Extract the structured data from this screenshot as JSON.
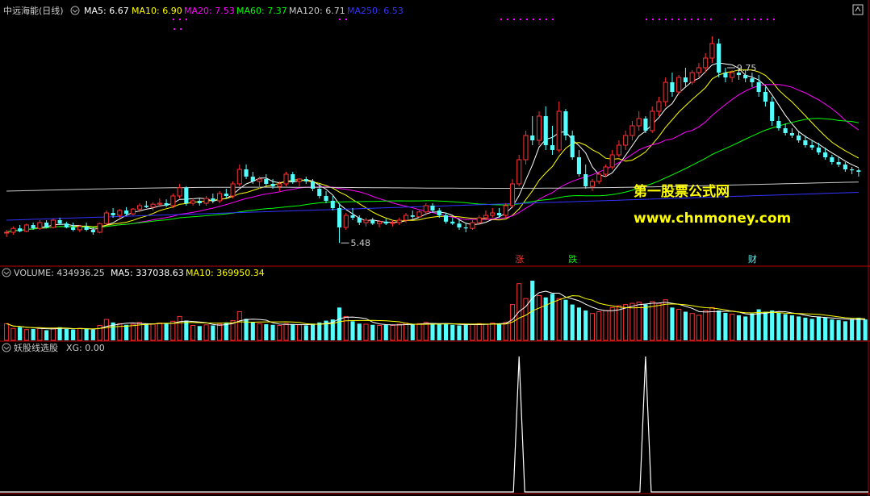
{
  "header": {
    "stock_title": "中远海能(日线)",
    "ma5": "MA5: 6.67",
    "ma10": "MA10: 6.90",
    "ma20": "MA20: 7.53",
    "ma60": "MA60: 7.37",
    "ma120": "MA120: 6.71",
    "ma250": "MA250: 6.53"
  },
  "volume_header": {
    "title": "VOLUME: 434936.25",
    "ma5": "MA5: 337038.63",
    "ma10": "MA10: 369950.34"
  },
  "indicator_header": {
    "title": "妖股线选股",
    "xg": "XG: 0.00"
  },
  "annotations": {
    "high": "9.75",
    "low": "5.48",
    "tag_zhang": "涨",
    "tag_die": "跌",
    "tag_cai": "财"
  },
  "watermark": {
    "line1": "第一股票公式网",
    "line2": "www.chnmoney.com"
  },
  "colors": {
    "up": "#ff3232",
    "down": "#54ffff",
    "ma5": "#ffffff",
    "ma10": "#ffff00",
    "ma20": "#ff00ff",
    "ma60": "#00ff00",
    "ma120": "#cccccc",
    "ma250": "#3333ff",
    "frame": "#b40000",
    "watermark": "#ffff00"
  },
  "chart_data": {
    "type": "candlestick",
    "price_range": [
      5.2,
      10.0
    ],
    "candles": [
      [
        5.7,
        5.75,
        5.6,
        5.7
      ],
      [
        5.7,
        5.82,
        5.65,
        5.78
      ],
      [
        5.78,
        5.85,
        5.7,
        5.72
      ],
      [
        5.72,
        5.88,
        5.7,
        5.85
      ],
      [
        5.85,
        5.9,
        5.75,
        5.78
      ],
      [
        5.78,
        5.95,
        5.75,
        5.9
      ],
      [
        5.9,
        5.95,
        5.78,
        5.8
      ],
      [
        5.8,
        5.98,
        5.78,
        5.95
      ],
      [
        5.95,
        6.0,
        5.85,
        5.88
      ],
      [
        5.88,
        5.92,
        5.78,
        5.8
      ],
      [
        5.8,
        5.9,
        5.72,
        5.75
      ],
      [
        5.75,
        5.85,
        5.7,
        5.82
      ],
      [
        5.82,
        5.9,
        5.72,
        5.75
      ],
      [
        5.75,
        5.82,
        5.65,
        5.7
      ],
      [
        5.7,
        5.9,
        5.68,
        5.88
      ],
      [
        5.88,
        6.15,
        5.85,
        6.1
      ],
      [
        6.1,
        6.2,
        6.0,
        6.05
      ],
      [
        6.05,
        6.18,
        6.0,
        6.15
      ],
      [
        6.15,
        6.22,
        6.05,
        6.08
      ],
      [
        6.08,
        6.2,
        6.05,
        6.18
      ],
      [
        6.18,
        6.3,
        6.12,
        6.25
      ],
      [
        6.25,
        6.35,
        6.2,
        6.22
      ],
      [
        6.22,
        6.32,
        6.15,
        6.28
      ],
      [
        6.28,
        6.4,
        6.22,
        6.3
      ],
      [
        6.3,
        6.38,
        6.22,
        6.25
      ],
      [
        6.25,
        6.5,
        6.2,
        6.45
      ],
      [
        6.45,
        6.7,
        6.4,
        6.62
      ],
      [
        6.62,
        6.65,
        6.25,
        6.3
      ],
      [
        6.3,
        6.4,
        6.25,
        6.35
      ],
      [
        6.35,
        6.4,
        6.25,
        6.3
      ],
      [
        6.3,
        6.45,
        6.25,
        6.4
      ],
      [
        6.4,
        6.5,
        6.3,
        6.35
      ],
      [
        6.35,
        6.55,
        6.3,
        6.5
      ],
      [
        6.5,
        6.6,
        6.4,
        6.45
      ],
      [
        6.45,
        6.75,
        6.4,
        6.7
      ],
      [
        6.7,
        7.1,
        6.65,
        7.0
      ],
      [
        7.0,
        7.1,
        6.8,
        6.85
      ],
      [
        6.85,
        6.95,
        6.7,
        6.75
      ],
      [
        6.75,
        6.85,
        6.6,
        6.8
      ],
      [
        6.8,
        6.9,
        6.65,
        6.7
      ],
      [
        6.7,
        6.8,
        6.6,
        6.65
      ],
      [
        6.65,
        6.75,
        6.55,
        6.7
      ],
      [
        6.7,
        6.95,
        6.65,
        6.9
      ],
      [
        6.9,
        6.95,
        6.7,
        6.75
      ],
      [
        6.75,
        6.82,
        6.65,
        6.8
      ],
      [
        6.8,
        6.85,
        6.7,
        6.75
      ],
      [
        6.75,
        6.8,
        6.55,
        6.6
      ],
      [
        6.6,
        6.7,
        6.4,
        6.45
      ],
      [
        6.45,
        6.55,
        6.3,
        6.35
      ],
      [
        6.35,
        6.45,
        6.15,
        6.2
      ],
      [
        6.2,
        6.3,
        5.48,
        5.8
      ],
      [
        5.8,
        6.1,
        5.75,
        6.05
      ],
      [
        6.05,
        6.2,
        5.95,
        6.0
      ],
      [
        6.0,
        6.05,
        5.85,
        5.9
      ],
      [
        5.9,
        6.0,
        5.82,
        5.95
      ],
      [
        5.95,
        6.0,
        5.85,
        5.88
      ],
      [
        5.88,
        5.95,
        5.8,
        5.92
      ],
      [
        5.92,
        5.98,
        5.85,
        5.88
      ],
      [
        5.88,
        5.95,
        5.82,
        5.9
      ],
      [
        5.9,
        6.0,
        5.85,
        5.95
      ],
      [
        5.95,
        6.1,
        5.9,
        6.05
      ],
      [
        6.05,
        6.15,
        5.98,
        6.02
      ],
      [
        6.02,
        6.15,
        6.0,
        6.12
      ],
      [
        6.12,
        6.3,
        6.05,
        6.25
      ],
      [
        6.25,
        6.3,
        6.1,
        6.15
      ],
      [
        6.15,
        6.2,
        6.0,
        6.05
      ],
      [
        6.05,
        6.1,
        5.88,
        5.92
      ],
      [
        5.92,
        6.0,
        5.85,
        5.88
      ],
      [
        5.88,
        5.95,
        5.75,
        5.8
      ],
      [
        5.8,
        5.9,
        5.7,
        5.78
      ],
      [
        5.78,
        5.95,
        5.75,
        5.9
      ],
      [
        5.9,
        6.05,
        5.85,
        6.0
      ],
      [
        6.0,
        6.15,
        5.95,
        6.05
      ],
      [
        6.05,
        6.2,
        6.0,
        6.1
      ],
      [
        6.1,
        6.2,
        6.0,
        6.05
      ],
      [
        6.05,
        6.3,
        6.0,
        6.25
      ],
      [
        6.25,
        6.8,
        6.2,
        6.7
      ],
      [
        6.7,
        7.3,
        6.65,
        7.2
      ],
      [
        7.2,
        7.8,
        7.1,
        7.7
      ],
      [
        7.7,
        8.1,
        7.5,
        7.6
      ],
      [
        7.6,
        8.2,
        7.5,
        8.1
      ],
      [
        8.1,
        8.3,
        7.4,
        7.5
      ],
      [
        7.5,
        7.9,
        7.3,
        7.4
      ],
      [
        7.4,
        8.4,
        7.35,
        8.2
      ],
      [
        8.2,
        8.25,
        7.6,
        7.7
      ],
      [
        7.7,
        7.8,
        7.2,
        7.25
      ],
      [
        7.25,
        7.4,
        6.85,
        6.9
      ],
      [
        6.9,
        7.1,
        6.6,
        6.65
      ],
      [
        6.65,
        6.8,
        6.55,
        6.75
      ],
      [
        6.75,
        6.95,
        6.7,
        6.9
      ],
      [
        6.9,
        7.1,
        6.85,
        7.05
      ],
      [
        7.05,
        7.4,
        7.0,
        7.3
      ],
      [
        7.3,
        7.6,
        7.25,
        7.5
      ],
      [
        7.5,
        7.8,
        7.4,
        7.7
      ],
      [
        7.7,
        8.0,
        7.6,
        7.9
      ],
      [
        7.9,
        8.2,
        7.8,
        8.05
      ],
      [
        8.05,
        8.1,
        7.75,
        7.8
      ],
      [
        7.8,
        8.3,
        7.75,
        8.2
      ],
      [
        8.2,
        8.5,
        8.1,
        8.4
      ],
      [
        8.4,
        8.9,
        8.3,
        8.8
      ],
      [
        8.8,
        9.0,
        8.5,
        8.6
      ],
      [
        8.6,
        8.95,
        8.55,
        8.9
      ],
      [
        8.9,
        9.1,
        8.7,
        8.8
      ],
      [
        8.8,
        9.05,
        8.75,
        9.0
      ],
      [
        9.0,
        9.2,
        8.9,
        9.1
      ],
      [
        9.1,
        9.4,
        9.0,
        9.3
      ],
      [
        9.3,
        9.75,
        9.2,
        9.6
      ],
      [
        9.6,
        9.7,
        8.9,
        9.0
      ],
      [
        9.0,
        9.1,
        8.8,
        8.9
      ],
      [
        8.9,
        9.05,
        8.8,
        9.0
      ],
      [
        9.0,
        9.1,
        8.85,
        8.95
      ],
      [
        8.95,
        9.05,
        8.8,
        8.88
      ],
      [
        8.88,
        9.0,
        8.7,
        8.8
      ],
      [
        8.8,
        8.95,
        8.5,
        8.6
      ],
      [
        8.6,
        8.7,
        8.3,
        8.4
      ],
      [
        8.4,
        8.5,
        7.9,
        8.0
      ],
      [
        8.0,
        8.1,
        7.8,
        7.85
      ],
      [
        7.85,
        7.95,
        7.7,
        7.75
      ],
      [
        7.75,
        7.85,
        7.65,
        7.7
      ],
      [
        7.7,
        7.8,
        7.55,
        7.6
      ],
      [
        7.6,
        7.7,
        7.45,
        7.5
      ],
      [
        7.5,
        7.6,
        7.4,
        7.45
      ],
      [
        7.45,
        7.55,
        7.3,
        7.35
      ],
      [
        7.35,
        7.45,
        7.2,
        7.25
      ],
      [
        7.25,
        7.3,
        7.1,
        7.15
      ],
      [
        7.15,
        7.25,
        7.05,
        7.1
      ],
      [
        7.1,
        7.15,
        6.95,
        7.0
      ],
      [
        7.0,
        7.05,
        6.9,
        6.98
      ],
      [
        6.98,
        7.02,
        6.85,
        6.95
      ]
    ],
    "volume": [
      0.28,
      0.2,
      0.22,
      0.18,
      0.19,
      0.21,
      0.17,
      0.2,
      0.22,
      0.19,
      0.18,
      0.2,
      0.19,
      0.18,
      0.25,
      0.35,
      0.3,
      0.28,
      0.26,
      0.27,
      0.3,
      0.28,
      0.27,
      0.29,
      0.28,
      0.32,
      0.4,
      0.33,
      0.25,
      0.24,
      0.26,
      0.25,
      0.27,
      0.3,
      0.33,
      0.48,
      0.36,
      0.3,
      0.28,
      0.27,
      0.26,
      0.25,
      0.28,
      0.27,
      0.26,
      0.25,
      0.28,
      0.3,
      0.33,
      0.35,
      0.55,
      0.4,
      0.32,
      0.28,
      0.27,
      0.26,
      0.25,
      0.26,
      0.25,
      0.27,
      0.29,
      0.27,
      0.28,
      0.3,
      0.28,
      0.27,
      0.28,
      0.26,
      0.25,
      0.26,
      0.27,
      0.28,
      0.27,
      0.29,
      0.28,
      0.3,
      0.6,
      0.95,
      0.7,
      1.0,
      0.75,
      0.72,
      0.78,
      0.7,
      0.68,
      0.6,
      0.55,
      0.5,
      0.45,
      0.48,
      0.5,
      0.55,
      0.58,
      0.6,
      0.62,
      0.64,
      0.6,
      0.65,
      0.62,
      0.68,
      0.55,
      0.52,
      0.48,
      0.45,
      0.42,
      0.5,
      0.55,
      0.5,
      0.46,
      0.44,
      0.42,
      0.4,
      0.45,
      0.52,
      0.48,
      0.5,
      0.46,
      0.44,
      0.42,
      0.4,
      0.38,
      0.36,
      0.4,
      0.38,
      0.35,
      0.34,
      0.32,
      0.36,
      0.38,
      0.35
    ],
    "ma60": [
      6.3,
      6.7,
      7.0,
      7.37
    ],
    "ma120": [
      6.71
    ],
    "ma250": [
      6.53
    ],
    "xg_signals": [
      77,
      96
    ],
    "label_positions": {
      "high_index": 108,
      "low_index": 50,
      "zhang_index": 77,
      "die_index": 85,
      "cai_index": 112
    }
  }
}
